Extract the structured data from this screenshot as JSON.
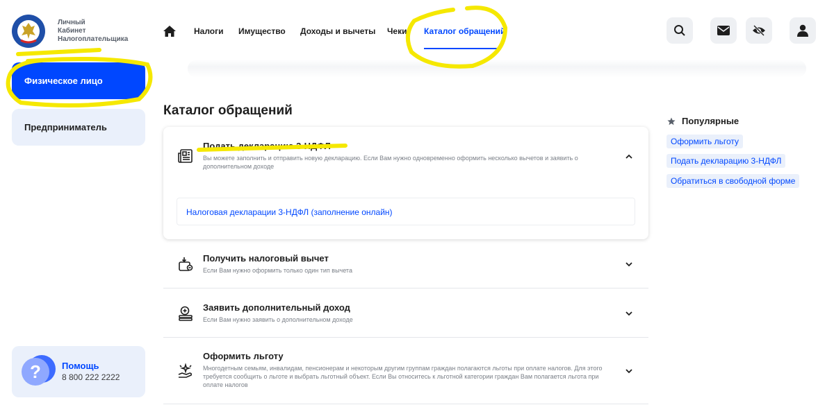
{
  "sidebar": {
    "logo_text": [
      "Личный",
      "Кабинет",
      "Налогоплательщика"
    ],
    "items": [
      {
        "label": "Физическое лицо",
        "active": true
      },
      {
        "label": "Предприниматель",
        "active": false
      }
    ],
    "help": {
      "title": "Помощь",
      "phone": "8 800 222 2222",
      "icon": "question-icon"
    }
  },
  "nav": {
    "home_icon": "home-icon",
    "items": [
      {
        "label": "Налоги"
      },
      {
        "label": "Имущество"
      },
      {
        "label": "Доходы и вычеты"
      },
      {
        "label": "Чеки"
      },
      {
        "label": "Каталог обращений",
        "active": true
      }
    ],
    "icons": [
      "search-icon",
      "mail-icon",
      "hide-eye-icon",
      "user-icon"
    ]
  },
  "main": {
    "title": "Каталог обращений",
    "items": [
      {
        "title": "Подать декларацию 3-НДФЛ",
        "desc": "Вы можете заполнить и отправить новую декларацию. Если Вам нужно одновременно оформить несколько вычетов и заявить о дополнительном доходе",
        "icon": "newspaper-icon",
        "expanded": true,
        "sub_link": "Налоговая декларации 3-НДФЛ (заполнение онлайн)"
      },
      {
        "title": "Получить налоговый вычет",
        "desc": "Если Вам нужно оформить только один тип вычета",
        "icon": "wallet-download-icon",
        "expanded": false
      },
      {
        "title": "Заявить дополнительный доход",
        "desc": "Если Вам нужно заявить о дополнительном доходе",
        "icon": "money-plus-icon",
        "expanded": false
      },
      {
        "title": "Оформить льготу",
        "desc": "Многодетным семьям, инвалидам, пенсионерам и некоторым другим группам граждан полагаются льготы при оплате налогов. Для этого требуется сообщить о льготе и выбрать льготный объект. Если Вы относитесь к льготной категории граждан Вам полагается льгота при оплате налогов",
        "icon": "hand-sparkle-icon",
        "expanded": false
      }
    ]
  },
  "popular": {
    "title": "Популярные",
    "tags": [
      "Оформить льготу",
      "Подать декларацию 3-НДФЛ",
      "Обратиться в свободной форме"
    ]
  },
  "colors": {
    "accent": "#0047ff",
    "highlight": "#f5e800",
    "chip_bg": "#eaf0fb"
  }
}
